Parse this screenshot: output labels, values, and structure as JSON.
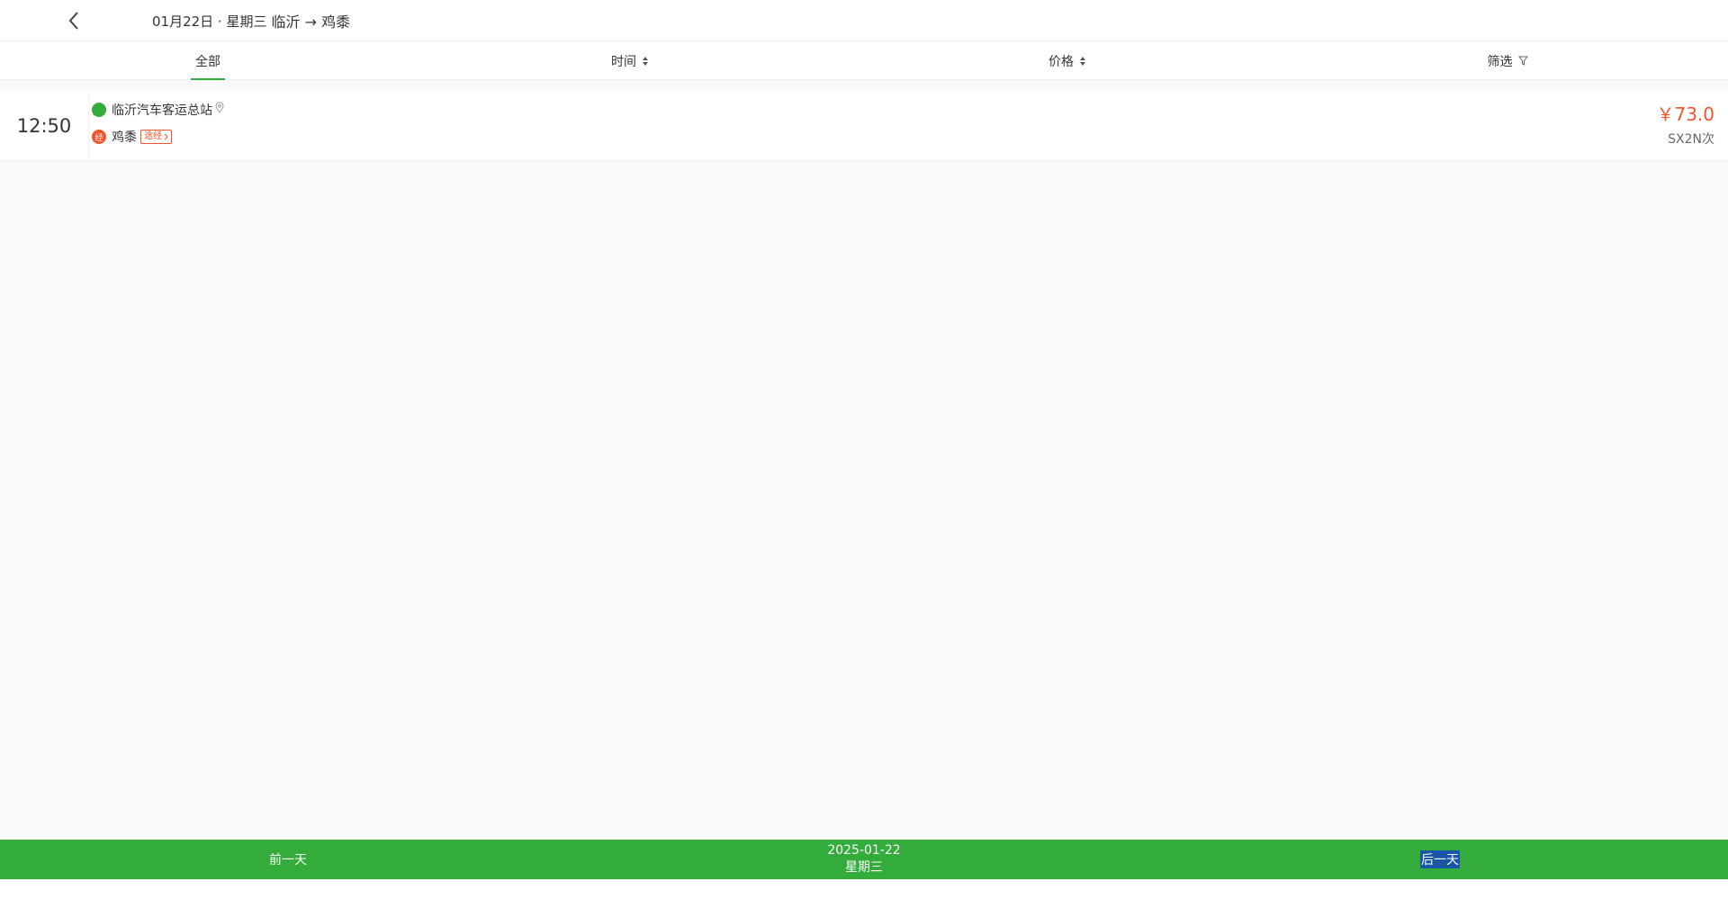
{
  "header": {
    "date_text": "01月22日 · 星期三",
    "route_text": "临沂 → 鸡黍",
    "back_icon": "chevron-left-icon"
  },
  "tabs": [
    {
      "label": "全部",
      "active": true
    },
    {
      "label": "时间",
      "icon": "sort-icon"
    },
    {
      "label": "价格",
      "icon": "sort-icon"
    },
    {
      "label": "筛选",
      "icon": "filter-icon"
    }
  ],
  "trips": [
    {
      "time": "12:50",
      "from_station": "临沂汽车客运总站",
      "to_station": "鸡黍",
      "via_badge": "经",
      "via_tag": "途经",
      "price": "￥73.0",
      "train_no": "SX2N次"
    }
  ],
  "bottom": {
    "prev_day": "前一天",
    "current_date": "2025-01-22",
    "current_weekday": "星期三",
    "next_day": "后一天"
  },
  "colors": {
    "accent": "#33ac3b",
    "price": "#f2552c",
    "selection": "#1a56a8"
  }
}
